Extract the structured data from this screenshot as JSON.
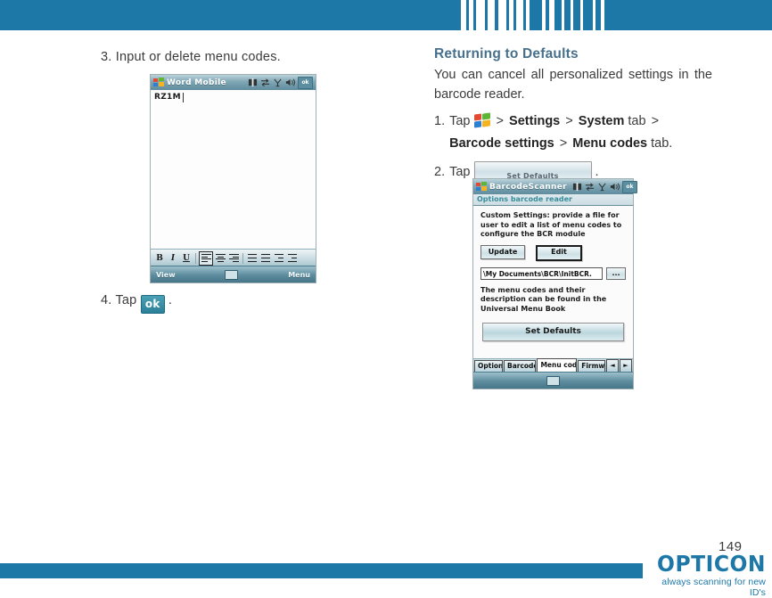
{
  "header": {
    "band_color": "#1d78a8",
    "barcode_name": "decorative-barcode-stripes",
    "barcode_bars": [
      6,
      3,
      5,
      3,
      10,
      3,
      8,
      4,
      9,
      3,
      5,
      3,
      8,
      3,
      4,
      14,
      4,
      4,
      6,
      8,
      3,
      7,
      3,
      8,
      3,
      11,
      3,
      10
    ]
  },
  "left_column": {
    "step3": "3. Input or delete menu codes.",
    "step4_prefix": "4. Tap",
    "step4_button": "ok",
    "step4_suffix": ".",
    "screenshot": {
      "name": "word-mobile-screenshot",
      "title": "Word Mobile",
      "document_text": "RZ1M",
      "format_buttons": [
        "B",
        "I",
        "U"
      ],
      "softkey_left": "View",
      "softkey_center_icon": "keyboard-icon",
      "softkey_right": "Menu",
      "titlebar_icons": [
        "volume-icon",
        "connectivity-icon",
        "signal-icon",
        "speaker-icon"
      ],
      "ok_button": "ok"
    }
  },
  "right_column": {
    "heading": "Returning to Defaults",
    "intro": "You can cancel all personalized settings in the barcode reader.",
    "step1": {
      "number": "1.",
      "tap": "Tap",
      "start_icon": "windows-start-icon",
      "sep": ">",
      "settings": "Settings",
      "system": "System",
      "tab_word": "tab",
      "barcode_settings": "Barcode settings",
      "menu_codes": "Menu codes",
      "tab_word2": "tab."
    },
    "step2": {
      "number": "2.",
      "tap": "Tap",
      "button_label": "Set Defaults",
      "suffix": "."
    },
    "screenshot": {
      "name": "barcode-scanner-screenshot",
      "title": "BarcodeScanner",
      "subtitle": "Options barcode reader",
      "description": "Custom Settings: provide a file for user to edit a list of menu codes to configure the BCR module",
      "update_button": "Update",
      "edit_button": "Edit",
      "path_value": "\\My Documents\\BCR\\InitBCR.",
      "browse_button": "...",
      "note": "The menu codes and their description can be found in the Universal Menu Book",
      "set_defaults_button": "Set Defaults",
      "tabs": [
        "Options",
        "Barcodes",
        "Menu codes",
        "Firmwa"
      ],
      "active_tab": "Menu codes",
      "prev_arrow": "◄",
      "next_arrow": "►",
      "ok_button": "ok"
    }
  },
  "footer": {
    "page_number": "149",
    "brand": "OPTICON",
    "tagline": "always scanning for new ID's",
    "bar_color": "#1d78a8"
  }
}
